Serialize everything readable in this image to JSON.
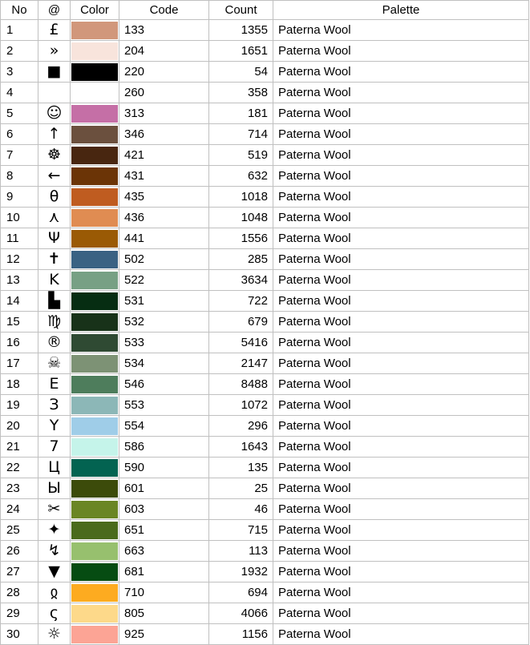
{
  "headers": {
    "no": "No",
    "symbol": "@",
    "color": "Color",
    "code": "Code",
    "count": "Count",
    "palette": "Palette"
  },
  "rows": [
    {
      "no": "1",
      "symbol": "£",
      "color": "#d1977b",
      "code": "133",
      "count": "1355",
      "palette": "Paterna Wool"
    },
    {
      "no": "2",
      "symbol": "»",
      "color": "#f8e4dc",
      "code": "204",
      "count": "1651",
      "palette": "Paterna Wool"
    },
    {
      "no": "3",
      "symbol": "■",
      "color": "#000000",
      "code": "220",
      "count": "54",
      "palette": "Paterna Wool"
    },
    {
      "no": "4",
      "symbol": "",
      "color": "#ffffff",
      "code": "260",
      "count": "358",
      "palette": "Paterna Wool"
    },
    {
      "no": "5",
      "symbol": "☺",
      "color": "#c56fa6",
      "code": "313",
      "count": "181",
      "palette": "Paterna Wool"
    },
    {
      "no": "6",
      "symbol": "↑",
      "color": "#6b503e",
      "code": "346",
      "count": "714",
      "palette": "Paterna Wool"
    },
    {
      "no": "7",
      "symbol": "☸",
      "color": "#482610",
      "code": "421",
      "count": "519",
      "palette": "Paterna Wool"
    },
    {
      "no": "8",
      "symbol": "←",
      "color": "#6b3406",
      "code": "431",
      "count": "632",
      "palette": "Paterna Wool"
    },
    {
      "no": "9",
      "symbol": "θ",
      "color": "#bf5c20",
      "code": "435",
      "count": "1018",
      "palette": "Paterna Wool"
    },
    {
      "no": "10",
      "symbol": "⋏",
      "color": "#e08c52",
      "code": "436",
      "count": "1048",
      "palette": "Paterna Wool"
    },
    {
      "no": "11",
      "symbol": "Ψ",
      "color": "#9a5a05",
      "code": "441",
      "count": "1556",
      "palette": "Paterna Wool"
    },
    {
      "no": "12",
      "symbol": "✝",
      "color": "#3a6283",
      "code": "502",
      "count": "285",
      "palette": "Paterna Wool"
    },
    {
      "no": "13",
      "symbol": "K",
      "color": "#77a084",
      "code": "522",
      "count": "3634",
      "palette": "Paterna Wool"
    },
    {
      "no": "14",
      "symbol": "▙",
      "color": "#062d12",
      "code": "531",
      "count": "722",
      "palette": "Paterna Wool"
    },
    {
      "no": "15",
      "symbol": "♍",
      "color": "#183219",
      "code": "532",
      "count": "679",
      "palette": "Paterna Wool"
    },
    {
      "no": "16",
      "symbol": "®",
      "color": "#2f4a33",
      "code": "533",
      "count": "5416",
      "palette": "Paterna Wool"
    },
    {
      "no": "17",
      "symbol": "☠",
      "color": "#7d9275",
      "code": "534",
      "count": "2147",
      "palette": "Paterna Wool"
    },
    {
      "no": "18",
      "symbol": "E",
      "color": "#4e7d5c",
      "code": "546",
      "count": "8488",
      "palette": "Paterna Wool"
    },
    {
      "no": "19",
      "symbol": "З",
      "color": "#8cb7b7",
      "code": "553",
      "count": "1072",
      "palette": "Paterna Wool"
    },
    {
      "no": "20",
      "symbol": "Y",
      "color": "#9fcde8",
      "code": "554",
      "count": "296",
      "palette": "Paterna Wool"
    },
    {
      "no": "21",
      "symbol": "7",
      "color": "#c5f4ea",
      "code": "586",
      "count": "1643",
      "palette": "Paterna Wool"
    },
    {
      "no": "22",
      "symbol": "Ц",
      "color": "#036351",
      "code": "590",
      "count": "135",
      "palette": "Paterna Wool"
    },
    {
      "no": "23",
      "symbol": "Ы",
      "color": "#3c4b0a",
      "code": "601",
      "count": "25",
      "palette": "Paterna Wool"
    },
    {
      "no": "24",
      "symbol": "✂",
      "color": "#6a8624",
      "code": "603",
      "count": "46",
      "palette": "Paterna Wool"
    },
    {
      "no": "25",
      "symbol": "✦",
      "color": "#4a6a1c",
      "code": "651",
      "count": "715",
      "palette": "Paterna Wool"
    },
    {
      "no": "26",
      "symbol": "↯",
      "color": "#97c06e",
      "code": "663",
      "count": "113",
      "palette": "Paterna Wool"
    },
    {
      "no": "27",
      "symbol": "▼",
      "color": "#064c12",
      "code": "681",
      "count": "1932",
      "palette": "Paterna Wool"
    },
    {
      "no": "28",
      "symbol": "ჲ",
      "color": "#fdab20",
      "code": "710",
      "count": "694",
      "palette": "Paterna Wool"
    },
    {
      "no": "29",
      "symbol": "ς",
      "color": "#fdd98a",
      "code": "805",
      "count": "4066",
      "palette": "Paterna Wool"
    },
    {
      "no": "30",
      "symbol": "☼",
      "color": "#fca495",
      "code": "925",
      "count": "1156",
      "palette": "Paterna Wool"
    }
  ]
}
